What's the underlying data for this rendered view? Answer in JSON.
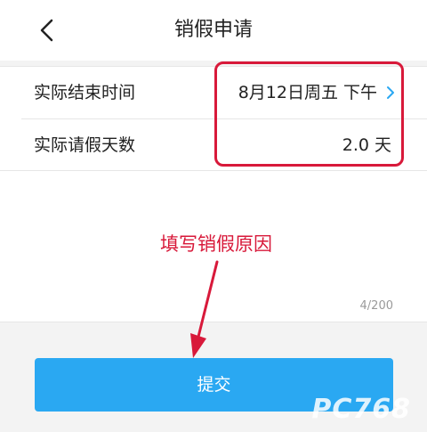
{
  "header": {
    "title": "销假申请",
    "back_icon": "chevron-left-icon"
  },
  "rows": [
    {
      "label": "实际结束时间",
      "value": "8月12日周五 下午",
      "has_chevron": true
    },
    {
      "label": "实际请假天数",
      "value": "2.0 天",
      "has_chevron": false
    }
  ],
  "reason": {
    "counter": "4/200"
  },
  "annotation": {
    "text": "填写销假原因",
    "color": "#d8193a"
  },
  "submit": {
    "label": "提交",
    "color": "#2aa8f2"
  },
  "watermark": "PC768"
}
